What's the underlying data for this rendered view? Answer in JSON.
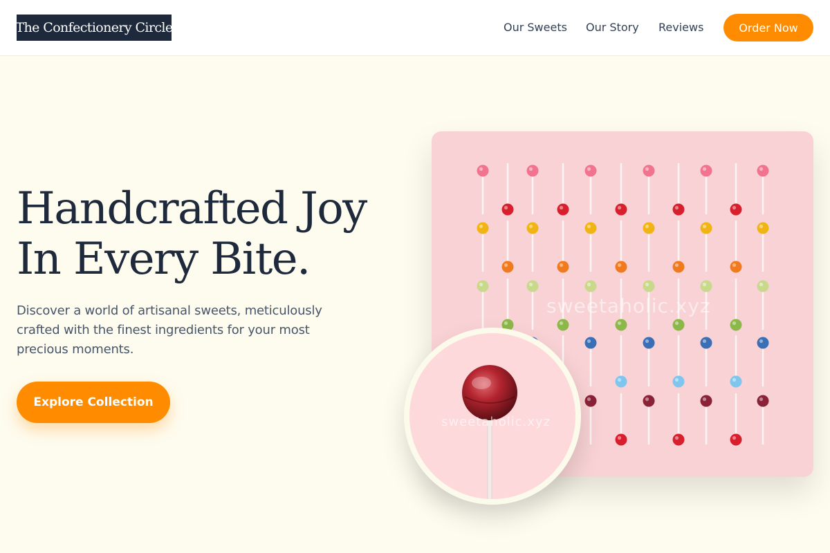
{
  "header": {
    "logo": "The Confectionery Circle",
    "nav": [
      "Our Sweets",
      "Our Story",
      "Reviews"
    ],
    "cta": "Order Now"
  },
  "hero": {
    "headline_line1": "Handcrafted Joy",
    "headline_line2": "In Every Bite.",
    "subtext": "Discover a world of artisanal sweets, meticulously crafted with the finest ingredients for your most precious moments.",
    "button": "Explore Collection"
  },
  "image": {
    "watermark": "sweetaholic.xyz",
    "inset_watermark": "sweetaholic.xyz"
  },
  "colors": {
    "accent": "#ff8c00",
    "dark": "#1e293b",
    "background": "#fefcef",
    "card_pink": "#f8d2d4"
  }
}
